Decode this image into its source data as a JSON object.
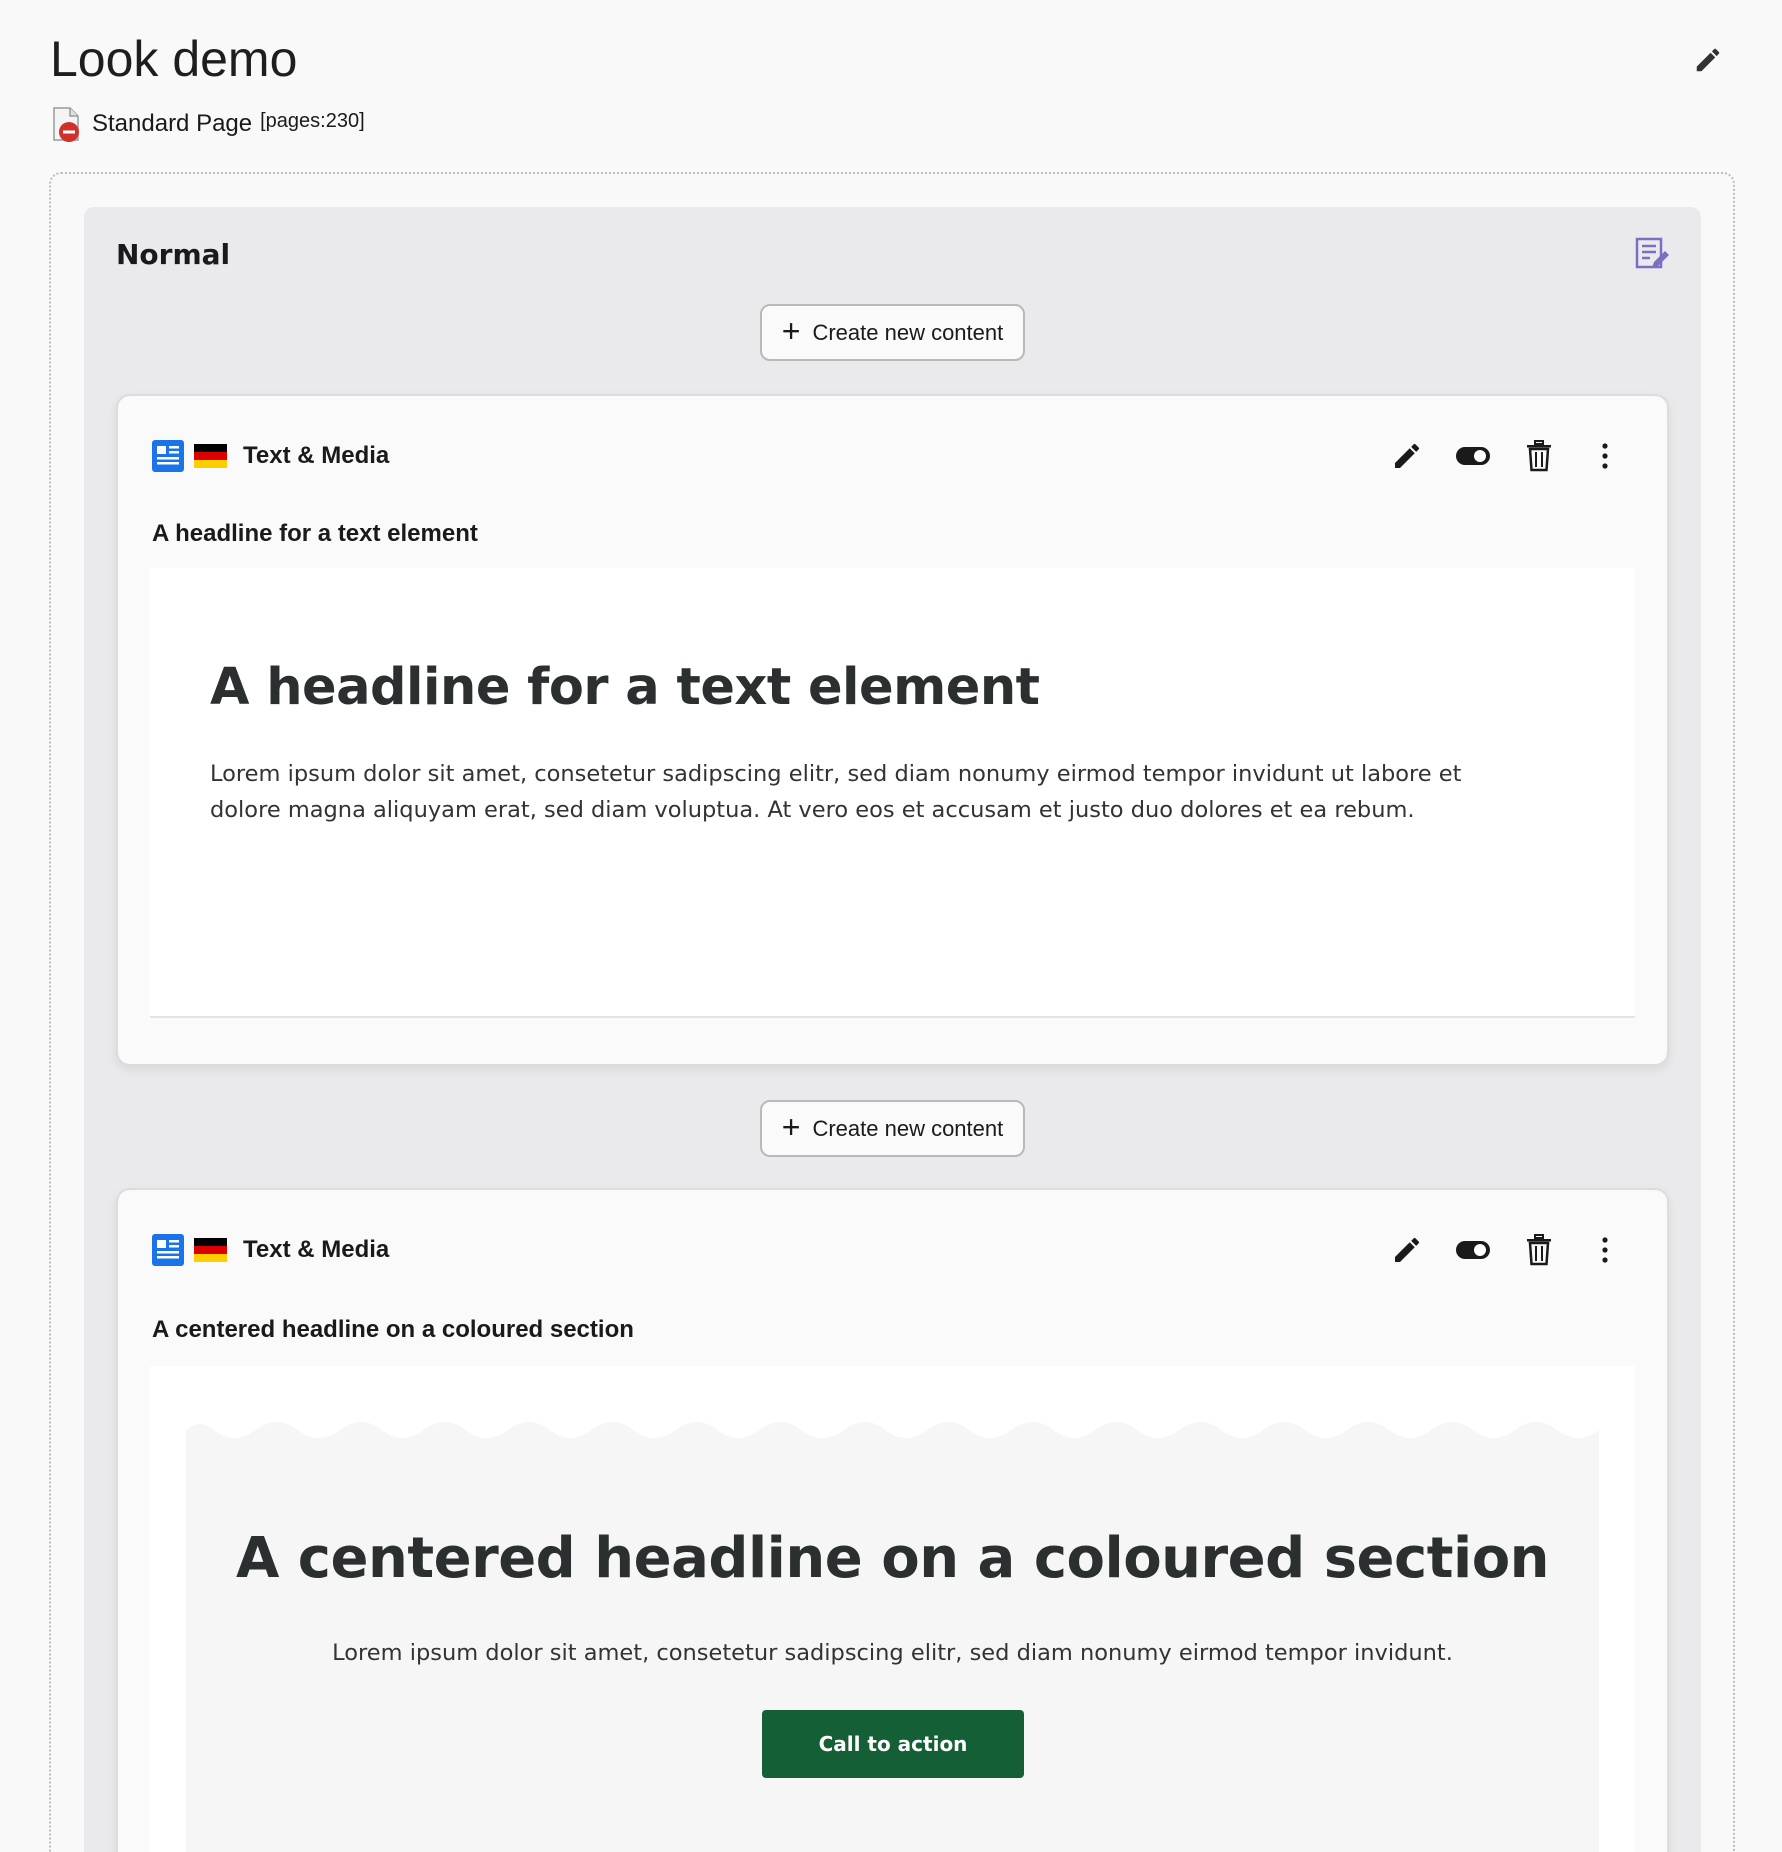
{
  "page": {
    "title": "Look demo",
    "type_label": "Standard Page",
    "id_label": "[pages:230]"
  },
  "column": {
    "title": "Normal"
  },
  "create_label": "Create new content",
  "colors": {
    "cta": "#155f37",
    "column_bg": "#eaeaec",
    "content_icon": "#1a73e8"
  },
  "cards": [
    {
      "type_label": "Text & Media",
      "language": "de",
      "header": "A headline for a text element",
      "preview": {
        "headline": "A headline for a text element",
        "text": "Lorem ipsum dolor sit amet, consetetur sadipscing elitr, sed diam nonumy eirmod tempor invidunt ut labore et dolore magna aliquyam erat, sed diam voluptua. At vero eos et accusam et justo duo dolores et ea rebum."
      }
    },
    {
      "type_label": "Text & Media",
      "language": "de",
      "header": "A centered headline on a coloured section",
      "preview": {
        "headline": "A centered headline on a coloured section",
        "text": "Lorem ipsum dolor sit amet, consetetur sadipscing elitr, sed diam nonumy eirmod tempor invidunt.",
        "cta_label": "Call to action"
      }
    }
  ]
}
